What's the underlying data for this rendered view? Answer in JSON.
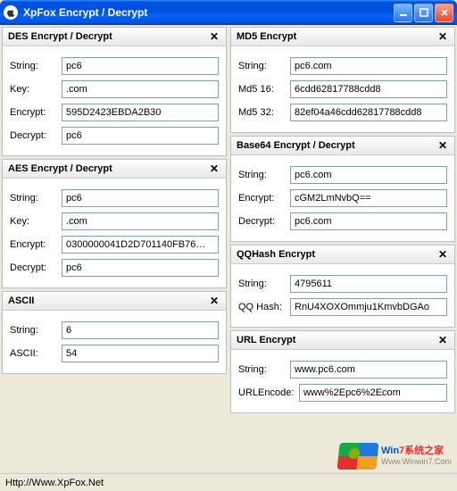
{
  "window": {
    "title": "XpFox Encrypt / Decrypt"
  },
  "panels": {
    "des": {
      "title": "DES  Encrypt / Decrypt",
      "string_label": "String:",
      "string_value": "pc6",
      "key_label": "Key:",
      "key_value": ".com",
      "encrypt_label": "Encrypt:",
      "encrypt_value": "595D2423EBDA2B30",
      "decrypt_label": "Decrypt:",
      "decrypt_value": "pc6"
    },
    "aes": {
      "title": "AES  Encrypt / Decrypt",
      "string_label": "String:",
      "string_value": "pc6",
      "key_label": "Key:",
      "key_value": ".com",
      "encrypt_label": "Encrypt:",
      "encrypt_value": "0300000041D2D701140FB76…",
      "decrypt_label": "Decrypt:",
      "decrypt_value": "pc6"
    },
    "ascii": {
      "title": "ASCII",
      "string_label": "String:",
      "string_value": "6",
      "ascii_label": "ASCII:",
      "ascii_value": "54"
    },
    "md5": {
      "title": "MD5 Encrypt",
      "string_label": "String:",
      "string_value": "pc6.com",
      "md516_label": "Md5 16:",
      "md516_value": "6cdd62817788cdd8",
      "md532_label": "Md5 32:",
      "md532_value": "82ef04a46cdd62817788cdd8"
    },
    "base64": {
      "title": "Base64  Encrypt / Decrypt",
      "string_label": "String:",
      "string_value": "pc6.com",
      "encrypt_label": "Encrypt:",
      "encrypt_value": "cGM2LmNvbQ==",
      "decrypt_label": "Decrypt:",
      "decrypt_value": "pc6.com"
    },
    "qqhash": {
      "title": "QQHash Encrypt",
      "string_label": "String:",
      "string_value": "4795611",
      "hash_label": "QQ Hash:",
      "hash_value": "RnU4XOXOmmju1KmvbDGAo"
    },
    "url": {
      "title": "URL Encrypt",
      "string_label": "String:",
      "string_value": "www.pc6.com",
      "encode_label": "URLEncode:",
      "encode_value": "www%2Epc6%2Ecom"
    }
  },
  "statusbar": {
    "text": "Http://Www.XpFox.Net"
  },
  "watermark": {
    "line1_a": "Win",
    "line1_b": "7",
    "line1_c": "系统之家",
    "line2": "Www.Winwin7.Com"
  }
}
